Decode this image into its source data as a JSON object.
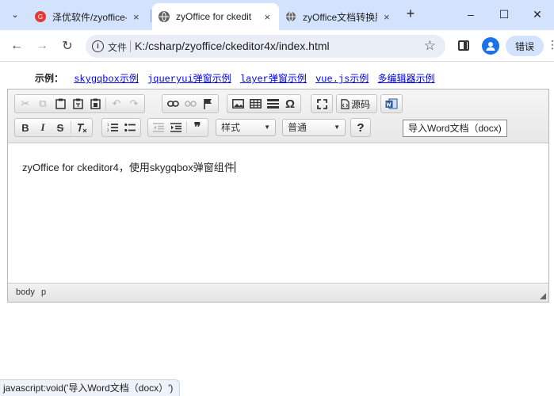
{
  "browser": {
    "tabs": [
      {
        "label": "泽优软件/zyoffice-",
        "icon_color": "#e53935",
        "icon_text": "G"
      },
      {
        "label": "zyOffice for ckedit",
        "icon_color": "#5f6368",
        "icon_text": ""
      },
      {
        "label": "zyOffice文档转换服",
        "icon_color": "#5f6368",
        "icon_text": ""
      }
    ],
    "tab_close": "×",
    "new_tab": "+",
    "tab_menu": "⌄",
    "win_minimize": "–",
    "win_maximize": "☐",
    "win_close": "✕",
    "back": "←",
    "forward": "→",
    "reload": "↻",
    "omnibox_info": "i",
    "omnibox_label": "文件",
    "url": "K:/csharp/zyoffice/ckeditor4x/index.html",
    "star": "☆",
    "error_label": "错误",
    "kebab": "⋮"
  },
  "page": {
    "examples_label": "示例：",
    "links": [
      "skygqbox示例",
      "jqueryui弹窗示例",
      "layer弹窗示例",
      "vue.js示例",
      "多编辑器示例"
    ]
  },
  "editor": {
    "style_combo": "样式",
    "format_combo": "普通",
    "source_label": "源码",
    "word_button": "导入Word文档（docx)",
    "content": "zyOffice for ckeditor4，使用skygqbox弹窗组件",
    "path": [
      "body",
      "p"
    ],
    "bold": "B",
    "italic": "I",
    "strike": "S",
    "help": "?"
  },
  "status": {
    "text": "javascript:void('导入Word文档（docx）')"
  }
}
